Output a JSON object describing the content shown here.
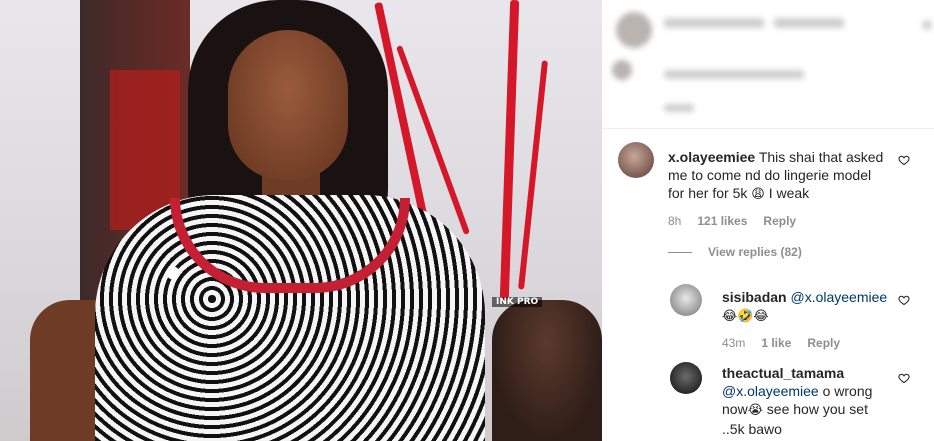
{
  "photo": {
    "watermark": "INK PRO"
  },
  "comments": [
    {
      "username": "x.olayeemiee",
      "text_line1": "This shai that asked",
      "text_line2": "me to come nd do lingerie model",
      "text_line3": "for her for 5k",
      "text_emoji": "😩",
      "text_line3_tail": " I weak",
      "time": "8h",
      "likes": "121 likes",
      "reply": "Reply",
      "view_replies": "View replies (82)"
    }
  ],
  "replies": [
    {
      "username": "sisibadan",
      "mention": "@x.olayeemiee",
      "emojis": "😂🤣😂",
      "time": "43m",
      "likes": "1 like",
      "reply": "Reply"
    },
    {
      "username": "theactual_tamama",
      "mention": "@x.olayeemiee",
      "text_a": " o wrong",
      "text_b": "now",
      "emoji": "😭",
      "text_c": " see how you set",
      "text_d": "..5k bawo"
    }
  ],
  "colors": {
    "accent_link": "#00376b",
    "meta_gray": "#8e8e8e",
    "text": "#262626"
  }
}
